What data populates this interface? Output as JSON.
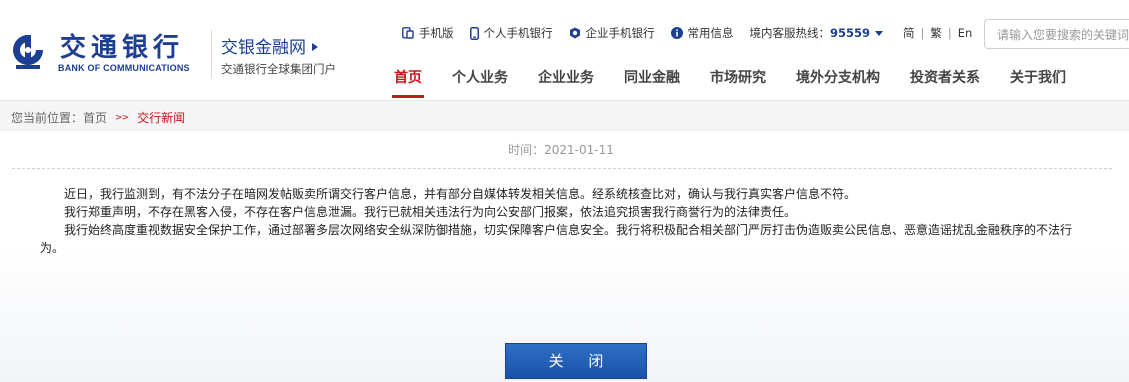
{
  "brand": {
    "name_cn": "交通银行",
    "name_en": "BANK OF COMMUNICATIONS",
    "portal_title": "交银金融网",
    "portal_subtitle": "交通银行全球集团门户"
  },
  "toplinks": [
    {
      "label": "手机版",
      "icon": "mobile-site-icon"
    },
    {
      "label": "个人手机银行",
      "icon": "phone-icon"
    },
    {
      "label": "企业手机银行",
      "icon": "corporate-app-icon"
    },
    {
      "label": "常用信息",
      "icon": "info-icon"
    }
  ],
  "hotline": {
    "label": "境内客服热线：",
    "number": "95559"
  },
  "languages": [
    "简",
    "繁",
    "En"
  ],
  "search": {
    "placeholder": "请输入您要搜索的关键词"
  },
  "nav": [
    "首页",
    "个人业务",
    "企业业务",
    "同业金融",
    "市场研究",
    "境外分支机构",
    "投资者关系",
    "关于我们"
  ],
  "nav_active": "首页",
  "breadcrumb": {
    "prefix": "您当前位置：",
    "home": "首页",
    "sep": ">>",
    "current": "交行新闻"
  },
  "article": {
    "date_label": "时间：2021-01-11",
    "paragraphs": [
      "近日，我行监测到，有不法分子在暗网发帖贩卖所谓交行客户信息，并有部分自媒体转发相关信息。经系统核查比对，确认与我行真实客户信息不符。",
      "我行郑重声明，不存在黑客入侵，不存在客户信息泄漏。我行已就相关违法行为向公安部门报案，依法追究损害我行商誉行为的法律责任。",
      "我行始终高度重视数据安全保护工作，通过部署多层次网络安全纵深防御措施，切实保障客户信息安全。我行将积极配合相关部门严厉打击伪造贩卖公民信息、恶意造谣扰乱金融秩序的不法行为。"
    ]
  },
  "close_button": "关 闭",
  "colors": {
    "brand_blue": "#1c3f94",
    "accent_red": "#c8161d",
    "button_blue": "#2563b8"
  }
}
